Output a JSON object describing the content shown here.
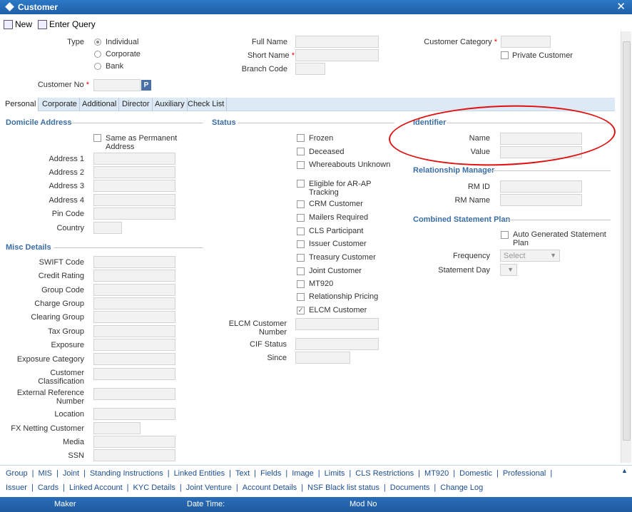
{
  "window": {
    "title": "Customer",
    "close": "✕"
  },
  "toolbar": {
    "new_label": "New",
    "enter_query_label": "Enter Query"
  },
  "header": {
    "type_label": "Type",
    "type_options": [
      "Individual",
      "Corporate",
      "Bank"
    ],
    "customer_no_label": "Customer No",
    "p_button": "P",
    "full_name_label": "Full Name",
    "short_name_label": "Short Name",
    "branch_code_label": "Branch Code",
    "customer_category_label": "Customer Category",
    "private_customer_label": "Private Customer",
    "req": "*"
  },
  "tabs": [
    "Personal",
    "Corporate",
    "Additional",
    "Director",
    "Auxiliary",
    "Check List"
  ],
  "domicile": {
    "title": "Domicile Address",
    "same_as_permanent": "Same as Permanent Address",
    "fields": [
      "Address 1",
      "Address 2",
      "Address 3",
      "Address 4",
      "Pin Code",
      "Country"
    ]
  },
  "misc": {
    "title": "Misc Details",
    "fields": [
      "SWIFT Code",
      "Credit Rating",
      "Group Code",
      "Charge Group",
      "Clearing Group",
      "Tax Group",
      "Exposure",
      "Exposure Category",
      "Customer Classification",
      "External Reference Number",
      "Location",
      "FX Netting Customer",
      "Media",
      "SSN"
    ]
  },
  "status": {
    "title": "Status",
    "checks": [
      "Frozen",
      "Deceased",
      "Whereabouts Unknown",
      "Eligible for AR-AP Tracking",
      "CRM Customer",
      "Mailers Required",
      "CLS Participant",
      "Issuer Customer",
      "Treasury Customer",
      "Joint Customer",
      "MT920",
      "Relationship Pricing",
      "ELCM Customer"
    ],
    "checked_mark": "✓",
    "elcm_customer_number_label": "ELCM Customer Number",
    "cif_status_label": "CIF Status",
    "since_label": "Since"
  },
  "identifier": {
    "title": "Identifier",
    "name_label": "Name",
    "value_label": "Value"
  },
  "rm": {
    "title": "Relationship Manager",
    "rm_id_label": "RM ID",
    "rm_name_label": "RM Name"
  },
  "csp": {
    "title": "Combined Statement Plan",
    "auto_generated_label": "Auto Generated Statement Plan",
    "frequency_label": "Frequency",
    "frequency_value": "Select",
    "statement_day_label": "Statement Day"
  },
  "links_row1": [
    "Group",
    "MIS",
    "Joint",
    "Standing Instructions",
    "Linked Entities",
    "Text",
    "Fields",
    "Image",
    "Limits",
    "CLS Restrictions",
    "MT920",
    "Domestic",
    "Professional"
  ],
  "links_row2": [
    "Issuer",
    "Cards",
    "Linked Account",
    "KYC Details",
    "Joint Venture",
    "Account Details",
    "NSF Black list status",
    "Documents",
    "Change Log"
  ],
  "link_separator": "|",
  "footer": {
    "maker_label": "Maker",
    "date_time_label": "Date Time:",
    "mod_no_label": "Mod No"
  },
  "colors": {
    "title_bar": "#1e5fa6",
    "tab_strip": "#dde9f5",
    "section_title": "#3a6ea5",
    "required": "#e00000",
    "annotation": "#e01010"
  }
}
